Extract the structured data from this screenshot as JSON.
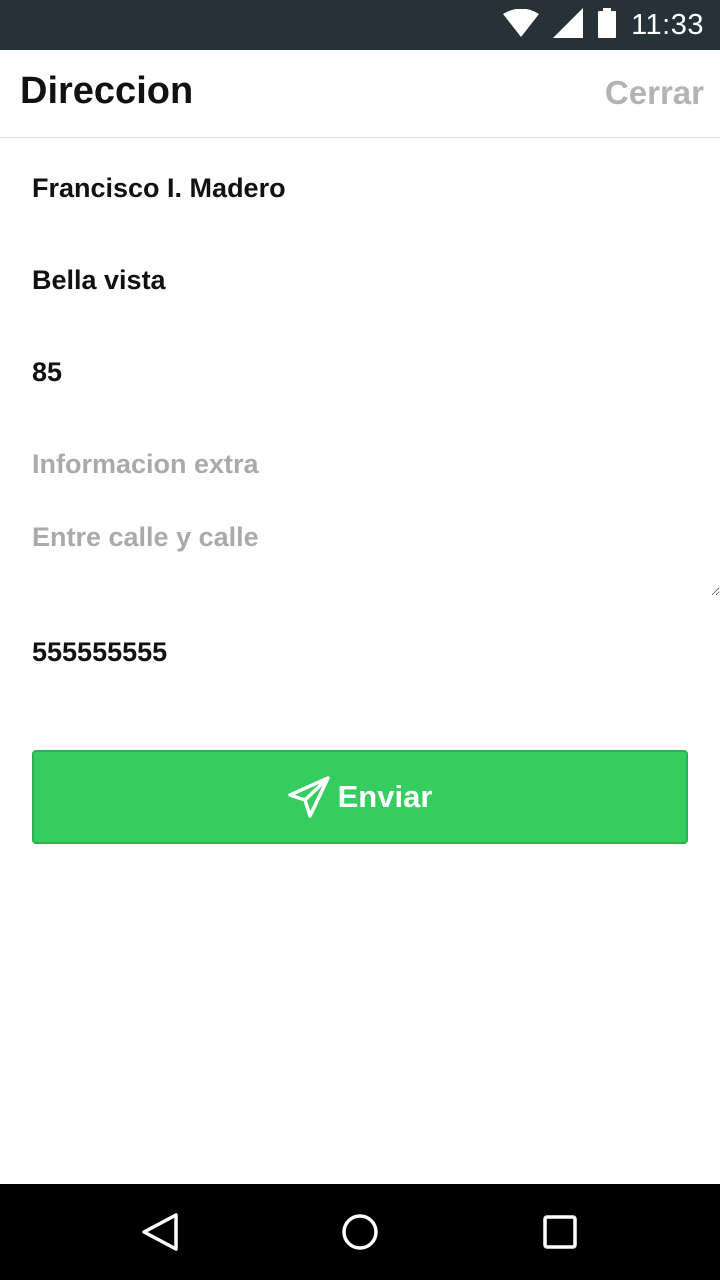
{
  "status_bar": {
    "time": "11:33",
    "icons": [
      "wifi-icon",
      "cell-signal-icon",
      "battery-icon"
    ]
  },
  "header": {
    "title": "Direccion",
    "close_label": "Cerrar"
  },
  "form": {
    "street": {
      "value": "Francisco I. Madero",
      "placeholder": ""
    },
    "colony": {
      "value": "Bella vista",
      "placeholder": ""
    },
    "number": {
      "value": "85",
      "placeholder": ""
    },
    "extra_info": {
      "value": "",
      "placeholder": "Informacion extra"
    },
    "between_streets": {
      "value": "",
      "placeholder": "Entre calle y calle"
    },
    "phone": {
      "value": "555555555",
      "placeholder": ""
    }
  },
  "send_button": {
    "label": "Enviar",
    "icon": "paper-plane-icon",
    "color": "#35cc60"
  },
  "nav_bar": {
    "icons": [
      "back-icon",
      "home-icon",
      "recent-apps-icon"
    ]
  },
  "colors": {
    "status_bar": "#263238",
    "placeholder": "#aaaaaa",
    "close_text": "#b3b3b3"
  }
}
